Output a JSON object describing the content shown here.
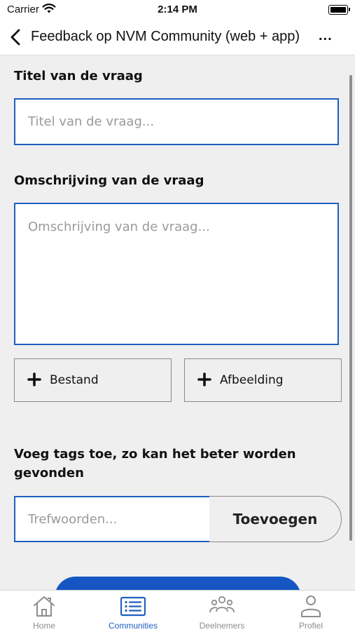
{
  "status_bar": {
    "carrier": "Carrier",
    "time": "2:14 PM"
  },
  "nav": {
    "title": "Feedback op NVM Community (web + app)",
    "more": "..."
  },
  "form": {
    "title_label": "Titel van de vraag",
    "title_placeholder": "Titel van de vraag...",
    "description_label": "Omschrijving van de vraag",
    "description_placeholder": "Omschrijving van de vraag...",
    "file_button": "Bestand",
    "image_button": "Afbeelding",
    "tags_label_line1": "Voeg tags toe, zo kan het beter worden",
    "tags_label_line2": "gevonden",
    "tags_placeholder": "Trefwoorden...",
    "tags_add_button": "Toevoegen"
  },
  "tabs": [
    {
      "label": "Home",
      "icon": "home-icon",
      "active": false
    },
    {
      "label": "Communities",
      "icon": "list-icon",
      "active": true
    },
    {
      "label": "Deelnemers",
      "icon": "people-icon",
      "active": false
    },
    {
      "label": "Profiel",
      "icon": "person-icon",
      "active": false
    }
  ],
  "colors": {
    "accent": "#1f5fbf",
    "submit": "#1556c4",
    "inactive_tab": "#8d8d8d",
    "background": "#efefef"
  }
}
